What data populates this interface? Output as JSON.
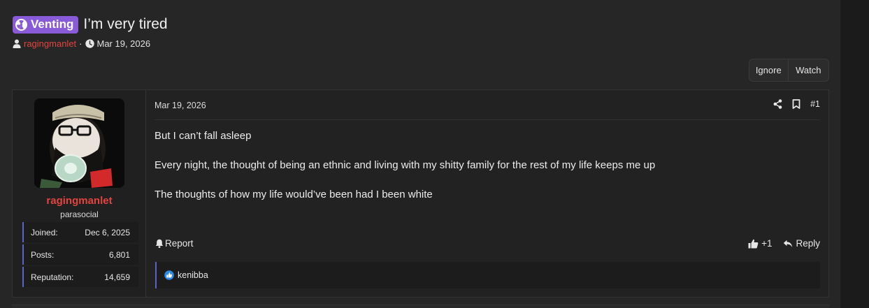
{
  "thread": {
    "prefix": "Venting",
    "title": "I’m very tired",
    "author": "ragingmanlet",
    "separator": "·",
    "date": "Mar 19, 2026"
  },
  "buttons": {
    "ignore": "Ignore",
    "watch": "Watch"
  },
  "post": {
    "date": "Mar 19, 2026",
    "number": "#1",
    "user": {
      "name": "ragingmanlet",
      "title": "parasocial",
      "stats": [
        {
          "label": "Joined:",
          "value": "Dec 6, 2025"
        },
        {
          "label": "Posts:",
          "value": "6,801"
        },
        {
          "label": "Reputation:",
          "value": "14,659"
        }
      ]
    },
    "message": [
      "But I can’t fall asleep",
      "Every night, the thought of being an ethnic and living with my shitty family for the rest of my life keeps me up",
      "The thoughts of how my life would’ve been had I been white"
    ],
    "report": "Report",
    "like_count": "+1",
    "reply": "Reply",
    "reactions_user": "kenibba"
  },
  "colors": {
    "accent_red": "#e0453f",
    "prefix_purple": "#8a5bd9",
    "stat_border": "#5b64c4",
    "like_blue": "#2d8ae6"
  },
  "icons": [
    "radiation-icon",
    "user-icon",
    "clock-icon",
    "share-icon",
    "bookmark-icon",
    "bell-icon",
    "thumbs-up-icon",
    "reply-icon",
    "like-reaction-icon"
  ]
}
